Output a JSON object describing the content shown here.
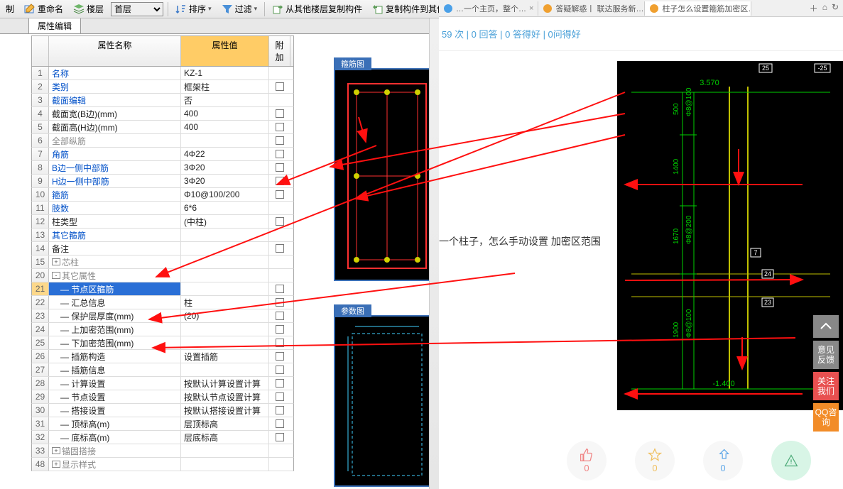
{
  "toolbar": {
    "copy_label": "制",
    "rename_label": "重命名",
    "floor_label": "楼层",
    "floor_select": "首层",
    "sort_label": "排序",
    "filter_label": "过滤",
    "copy_from_label": "从其他楼层复制构件",
    "copy_to_label": "复制构件到其他楼层"
  },
  "tabs": [
    {
      "label": "…一个主页，整个…",
      "close": "×"
    },
    {
      "label": "答疑解惑丨 联达服务新…",
      "close": "×"
    },
    {
      "label": "柱子怎么设置箍筋加密区…",
      "close": "×"
    }
  ],
  "prop_tab": "属性编辑",
  "headers": {
    "name": "属性名称",
    "value": "属性值",
    "extra": "附加"
  },
  "rows": [
    {
      "n": "1",
      "name": "名称",
      "value": "KZ-1",
      "color": "blue",
      "cb": false
    },
    {
      "n": "2",
      "name": "类别",
      "value": "框架柱",
      "color": "blue",
      "cb": true
    },
    {
      "n": "3",
      "name": "截面编辑",
      "value": "否",
      "color": "blue",
      "cb": false
    },
    {
      "n": "4",
      "name": "截面宽(B边)(mm)",
      "value": "400",
      "color": "black",
      "cb": true
    },
    {
      "n": "5",
      "name": "截面高(H边)(mm)",
      "value": "400",
      "color": "black",
      "cb": true
    },
    {
      "n": "6",
      "name": "全部纵筋",
      "value": "",
      "color": "gray",
      "cb": true
    },
    {
      "n": "7",
      "name": "角筋",
      "value": "4Φ22",
      "color": "blue",
      "cb": true
    },
    {
      "n": "8",
      "name": "B边一侧中部筋",
      "value": "3Φ20",
      "color": "blue",
      "cb": true
    },
    {
      "n": "9",
      "name": "H边一侧中部筋",
      "value": "3Φ20",
      "color": "blue",
      "cb": true
    },
    {
      "n": "10",
      "name": "箍筋",
      "value": "Φ10@100/200",
      "color": "blue",
      "cb": true
    },
    {
      "n": "11",
      "name": "肢数",
      "value": "6*6",
      "color": "blue",
      "cb": false
    },
    {
      "n": "12",
      "name": "柱类型",
      "value": "(中柱)",
      "color": "black",
      "cb": true
    },
    {
      "n": "13",
      "name": "其它箍筋",
      "value": "",
      "color": "blue",
      "cb": false
    },
    {
      "n": "14",
      "name": "备注",
      "value": "",
      "color": "black",
      "cb": true
    },
    {
      "n": "15",
      "name": "芯柱",
      "value": "",
      "color": "gray",
      "cb": false,
      "expand": "+"
    },
    {
      "n": "20",
      "name": "其它属性",
      "value": "",
      "color": "gray",
      "cb": false,
      "expand": "-"
    },
    {
      "n": "21",
      "name": "节点区箍筋",
      "value": "",
      "color": "black",
      "cb": true,
      "indent": 2,
      "selected": true
    },
    {
      "n": "22",
      "name": "汇总信息",
      "value": "柱",
      "color": "black",
      "cb": true,
      "indent": 2
    },
    {
      "n": "23",
      "name": "保护层厚度(mm)",
      "value": "(20)",
      "color": "black",
      "cb": true,
      "indent": 2
    },
    {
      "n": "24",
      "name": "上加密范围(mm)",
      "value": "",
      "color": "black",
      "cb": true,
      "indent": 2
    },
    {
      "n": "25",
      "name": "下加密范围(mm)",
      "value": "",
      "color": "black",
      "cb": true,
      "indent": 2
    },
    {
      "n": "26",
      "name": "插筋构造",
      "value": "设置插筋",
      "color": "black",
      "cb": true,
      "indent": 2
    },
    {
      "n": "27",
      "name": "插筋信息",
      "value": "",
      "color": "black",
      "cb": true,
      "indent": 2
    },
    {
      "n": "28",
      "name": "计算设置",
      "value": "按默认计算设置计算",
      "color": "black",
      "cb": true,
      "indent": 2
    },
    {
      "n": "29",
      "name": "节点设置",
      "value": "按默认节点设置计算",
      "color": "black",
      "cb": true,
      "indent": 2
    },
    {
      "n": "30",
      "name": "搭接设置",
      "value": "按默认搭接设置计算",
      "color": "black",
      "cb": true,
      "indent": 2
    },
    {
      "n": "31",
      "name": "顶标高(m)",
      "value": "层顶标高",
      "color": "black",
      "cb": true,
      "indent": 2
    },
    {
      "n": "32",
      "name": "底标高(m)",
      "value": "层底标高",
      "color": "black",
      "cb": true,
      "indent": 2
    },
    {
      "n": "33",
      "name": "锚固搭接",
      "value": "",
      "color": "gray",
      "cb": false,
      "expand": "+"
    },
    {
      "n": "48",
      "name": "显示样式",
      "value": "",
      "color": "gray",
      "cb": false,
      "expand": "+"
    }
  ],
  "diagrams": {
    "stirrup_title": "箍筋图",
    "param_title": "参数图"
  },
  "cad": {
    "dim_3570": "3.570",
    "dim_neg140": "-1.400",
    "v500": "500",
    "v1400": "1400",
    "v1670": "1670",
    "v1900": "1900",
    "stirrup_a": "Φ8@100",
    "stirrup_b": "Φ8@200",
    "stirrup_c": "Φ8@100",
    "tag25a": "25",
    "tag25b": "-25",
    "tag7": "7",
    "tag24": "24",
    "tag23": "23"
  },
  "stats_line": "59 次 | 0 回答 | 0 答得好 | 0问得好",
  "question": "一个柱子，怎么手动设置 加密区范围",
  "votes": {
    "like": "0",
    "star": "0",
    "share": "0"
  },
  "side": {
    "feedback": "意见反馈",
    "follow": "关注我们",
    "qq": "QQ咨询"
  }
}
